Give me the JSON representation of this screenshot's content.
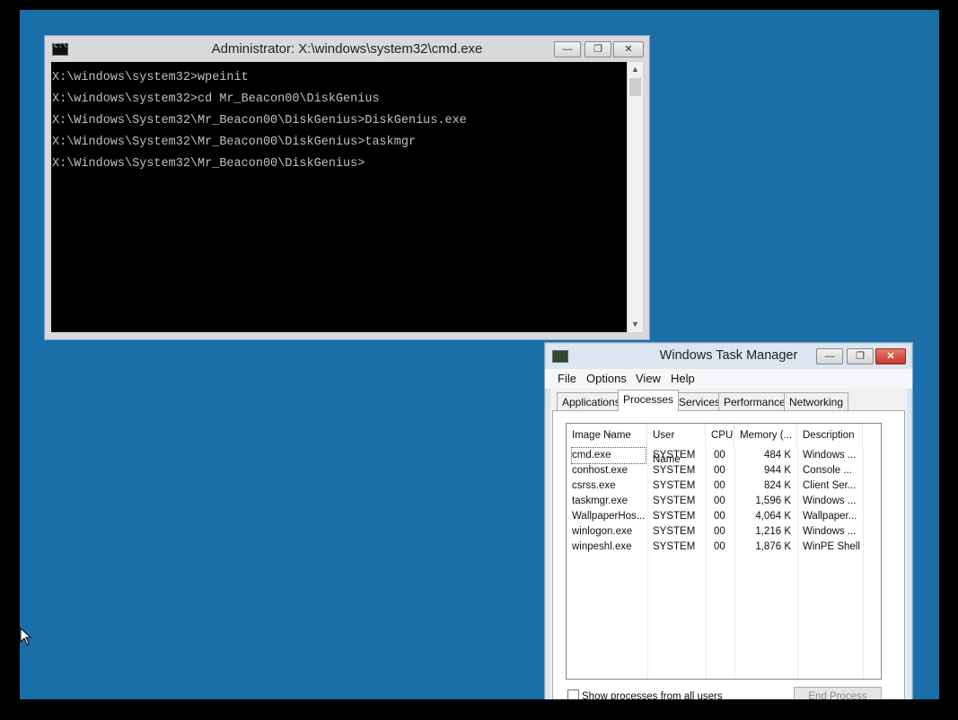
{
  "cmd": {
    "title": "Administrator: X:\\windows\\system32\\cmd.exe",
    "icon_label": "C:\\",
    "lines": [
      "X:\\windows\\system32>wpeinit",
      "X:\\windows\\system32>cd Mr_Beacon00\\DiskGenius",
      "X:\\Windows\\System32\\Mr_Beacon00\\DiskGenius>DiskGenius.exe",
      "X:\\Windows\\System32\\Mr_Beacon00\\DiskGenius>taskmgr",
      "X:\\Windows\\System32\\Mr_Beacon00\\DiskGenius>"
    ],
    "controls": {
      "minimize": "—",
      "maximize": "❐",
      "close": "✕"
    }
  },
  "taskmgr": {
    "title": "Windows Task Manager",
    "menu": [
      "File",
      "Options",
      "View",
      "Help"
    ],
    "tabs": [
      "Applications",
      "Processes",
      "Services",
      "Performance",
      "Networking"
    ],
    "active_tab": "Processes",
    "columns": [
      "Image Name",
      "User Name",
      "CPU",
      "Memory (...",
      "Description"
    ],
    "rows": [
      {
        "name": "cmd.exe",
        "user": "SYSTEM",
        "cpu": "00",
        "mem": "484 K",
        "desc": "Windows ..."
      },
      {
        "name": "conhost.exe",
        "user": "SYSTEM",
        "cpu": "00",
        "mem": "944 K",
        "desc": "Console ..."
      },
      {
        "name": "csrss.exe",
        "user": "SYSTEM",
        "cpu": "00",
        "mem": "824 K",
        "desc": "Client Ser..."
      },
      {
        "name": "taskmgr.exe",
        "user": "SYSTEM",
        "cpu": "00",
        "mem": "1,596 K",
        "desc": "Windows ..."
      },
      {
        "name": "WallpaperHos...",
        "user": "SYSTEM",
        "cpu": "00",
        "mem": "4,064 K",
        "desc": "Wallpaper..."
      },
      {
        "name": "winlogon.exe",
        "user": "SYSTEM",
        "cpu": "00",
        "mem": "1,216 K",
        "desc": "Windows ..."
      },
      {
        "name": "winpeshl.exe",
        "user": "SYSTEM",
        "cpu": "00",
        "mem": "1,876 K",
        "desc": "WinPE Shell"
      }
    ],
    "show_all_label": "Show processes from all users",
    "end_process_label": "End Process",
    "controls": {
      "minimize": "—",
      "maximize": "❐",
      "close": "✕"
    }
  },
  "colors": {
    "desktop": "#1a6fa8",
    "console_bg": "#000000",
    "console_text": "#c0c0c0"
  }
}
